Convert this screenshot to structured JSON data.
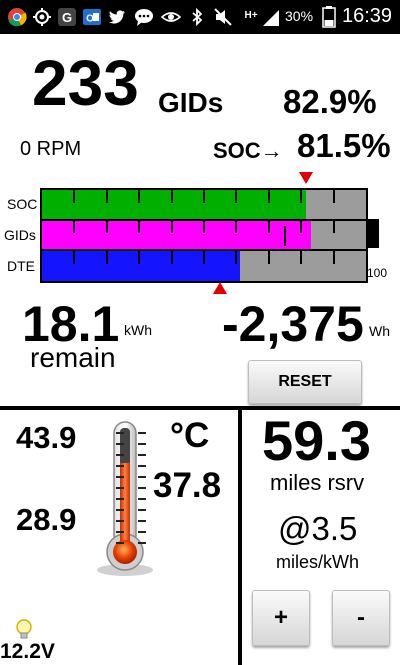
{
  "status_bar": {
    "time": "16:39",
    "battery_percent": "30%",
    "network": "H+",
    "icons": [
      "chrome-icon",
      "location-icon",
      "google-icon",
      "outlook-icon",
      "twitter-icon",
      "chat-icon",
      "eye-icon",
      "bluetooth-icon",
      "mute-icon",
      "network-icon",
      "signal-icon",
      "battery-icon"
    ]
  },
  "summary": {
    "gids_value": "233",
    "gids_unit": "GIDs",
    "gids_percent": "82.9%",
    "rpm": "0 RPM",
    "soc_label": "SOC→",
    "soc_percent": "81.5%"
  },
  "bars": {
    "labels": [
      "SOC",
      "GIDs",
      "DTE"
    ],
    "scale_max": "100",
    "soc_fraction": 0.815,
    "gids_fraction": 0.829,
    "dte_fraction": 0.61,
    "colors": {
      "soc": "#00b000",
      "gids": "#ff00ff",
      "dte": "#1414ff",
      "empty": "#9c9c9c",
      "marker": "#e00000"
    }
  },
  "energy": {
    "kwh_value": "18.1",
    "kwh_unit": "kWh",
    "remain_label": "remain",
    "wh_value": "-2,375",
    "wh_unit": "Wh",
    "reset_label": "RESET"
  },
  "temperature": {
    "high": "43.9",
    "low": "28.9",
    "unit": "°C",
    "current": "37.8",
    "voltage": "12.2V"
  },
  "range": {
    "miles_value": "59.3",
    "miles_label": "miles rsrv",
    "efficiency": "@3.5",
    "efficiency_unit": "miles/kWh",
    "plus_label": "+",
    "minus_label": "-"
  }
}
